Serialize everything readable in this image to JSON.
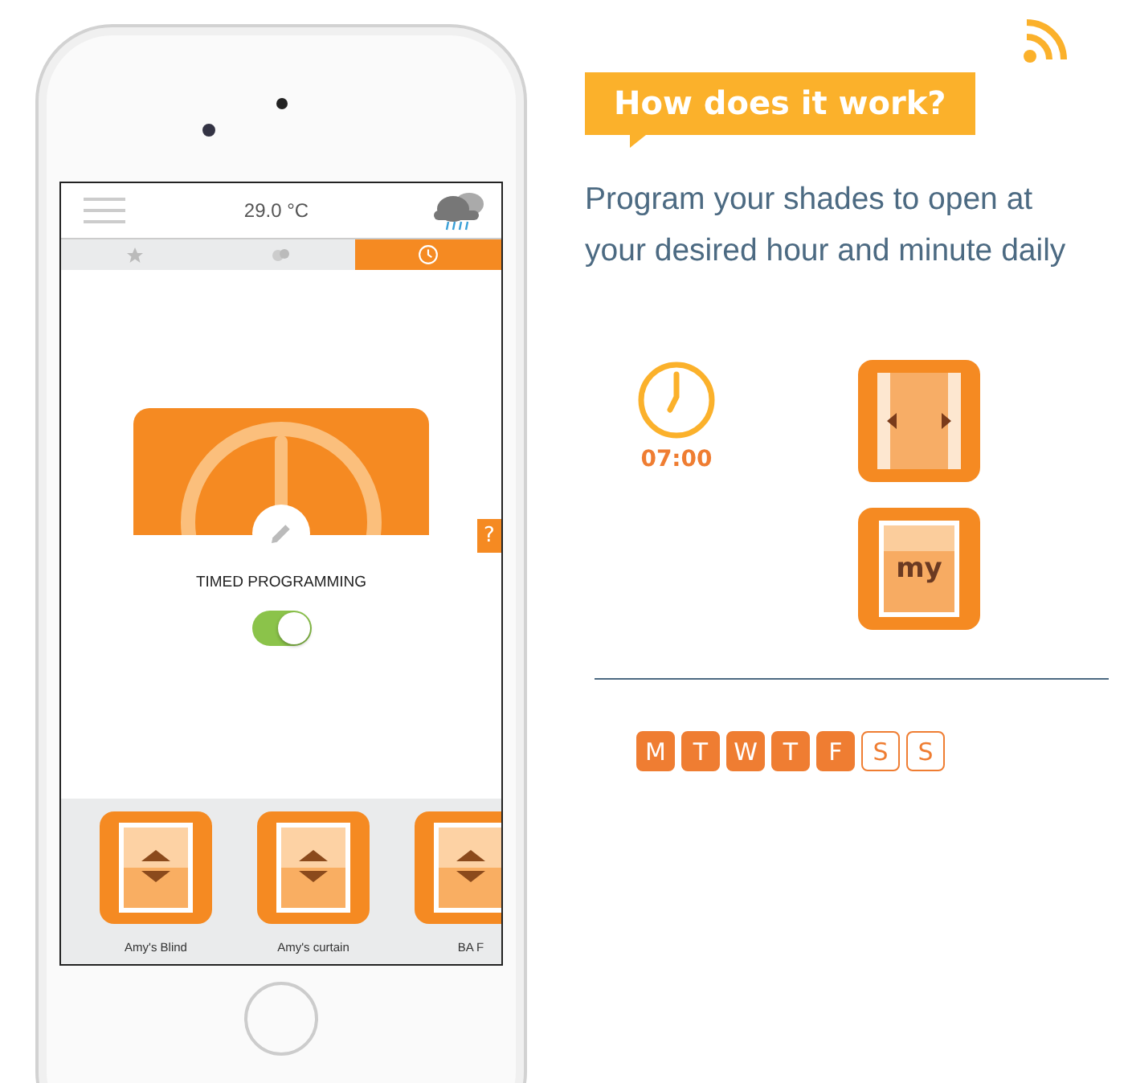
{
  "phone": {
    "temperature": "29.0 °C",
    "tabs": [
      {
        "kind": "star",
        "selected": false
      },
      {
        "kind": "scenes",
        "selected": false
      },
      {
        "kind": "clock",
        "selected": true
      }
    ],
    "help": "?",
    "feature": {
      "label": "TIMED PROGRAMMING",
      "on": true
    },
    "devices": [
      {
        "name": "Amy's Blind"
      },
      {
        "name": "Amy's curtain"
      },
      {
        "name": "BA F"
      }
    ]
  },
  "heading": "How does it work?",
  "description": "Program your shades to open at your desired hour and minute daily",
  "time": "07:00",
  "my_label": "my",
  "days": [
    {
      "label": "M",
      "selected": true
    },
    {
      "label": "T",
      "selected": true
    },
    {
      "label": "W",
      "selected": true
    },
    {
      "label": "T",
      "selected": true
    },
    {
      "label": "F",
      "selected": true
    },
    {
      "label": "S",
      "selected": false
    },
    {
      "label": "S",
      "selected": false
    }
  ]
}
